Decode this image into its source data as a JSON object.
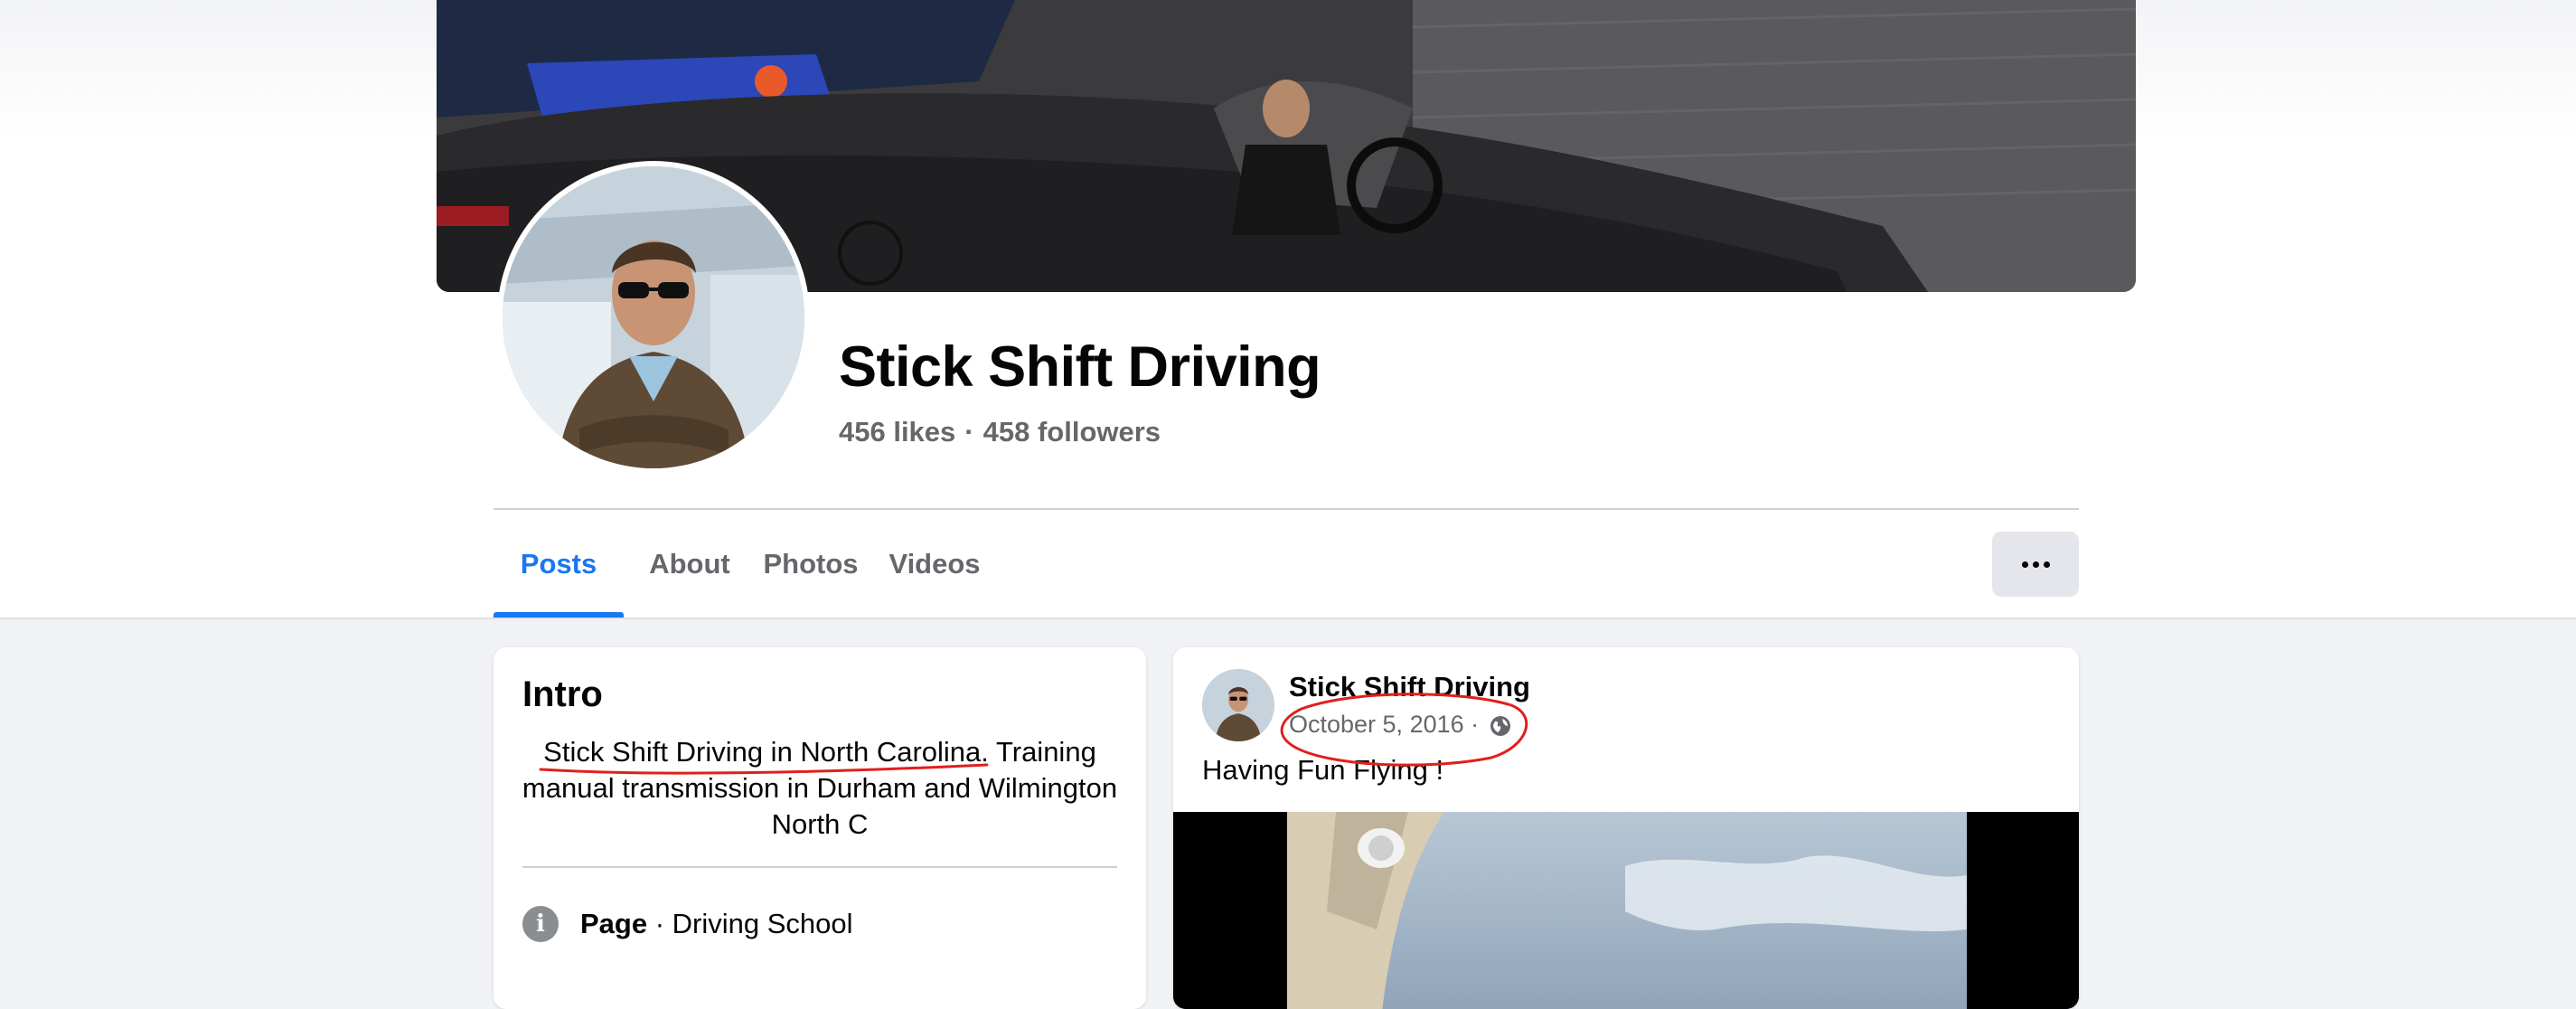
{
  "page": {
    "name": "Stick Shift Driving",
    "likes": "456 likes",
    "separator": "·",
    "followers": "458 followers"
  },
  "tabs": [
    {
      "label": "Posts",
      "active": true
    },
    {
      "label": "About",
      "active": false
    },
    {
      "label": "Photos",
      "active": false
    },
    {
      "label": "Videos",
      "active": false
    }
  ],
  "more_button": {
    "icon": "more-horizontal-icon"
  },
  "intro": {
    "title": "Intro",
    "bio_highlight": "Stick Shift Driving in North Carolina.",
    "bio_rest": " Training manual transmission in Durham and Wilmington North C",
    "category_label": "Page",
    "category_separator": " · ",
    "category_value": "Driving School",
    "info_icon": "info-icon"
  },
  "post": {
    "author": "Stick Shift Driving",
    "date": "October 5, 2016",
    "date_separator": " · ",
    "privacy_icon": "globe-icon",
    "text": "Having Fun Flying !"
  },
  "colors": {
    "accent": "#1877f2",
    "secondary_text": "#65676b",
    "annotation": "#e0201b"
  }
}
